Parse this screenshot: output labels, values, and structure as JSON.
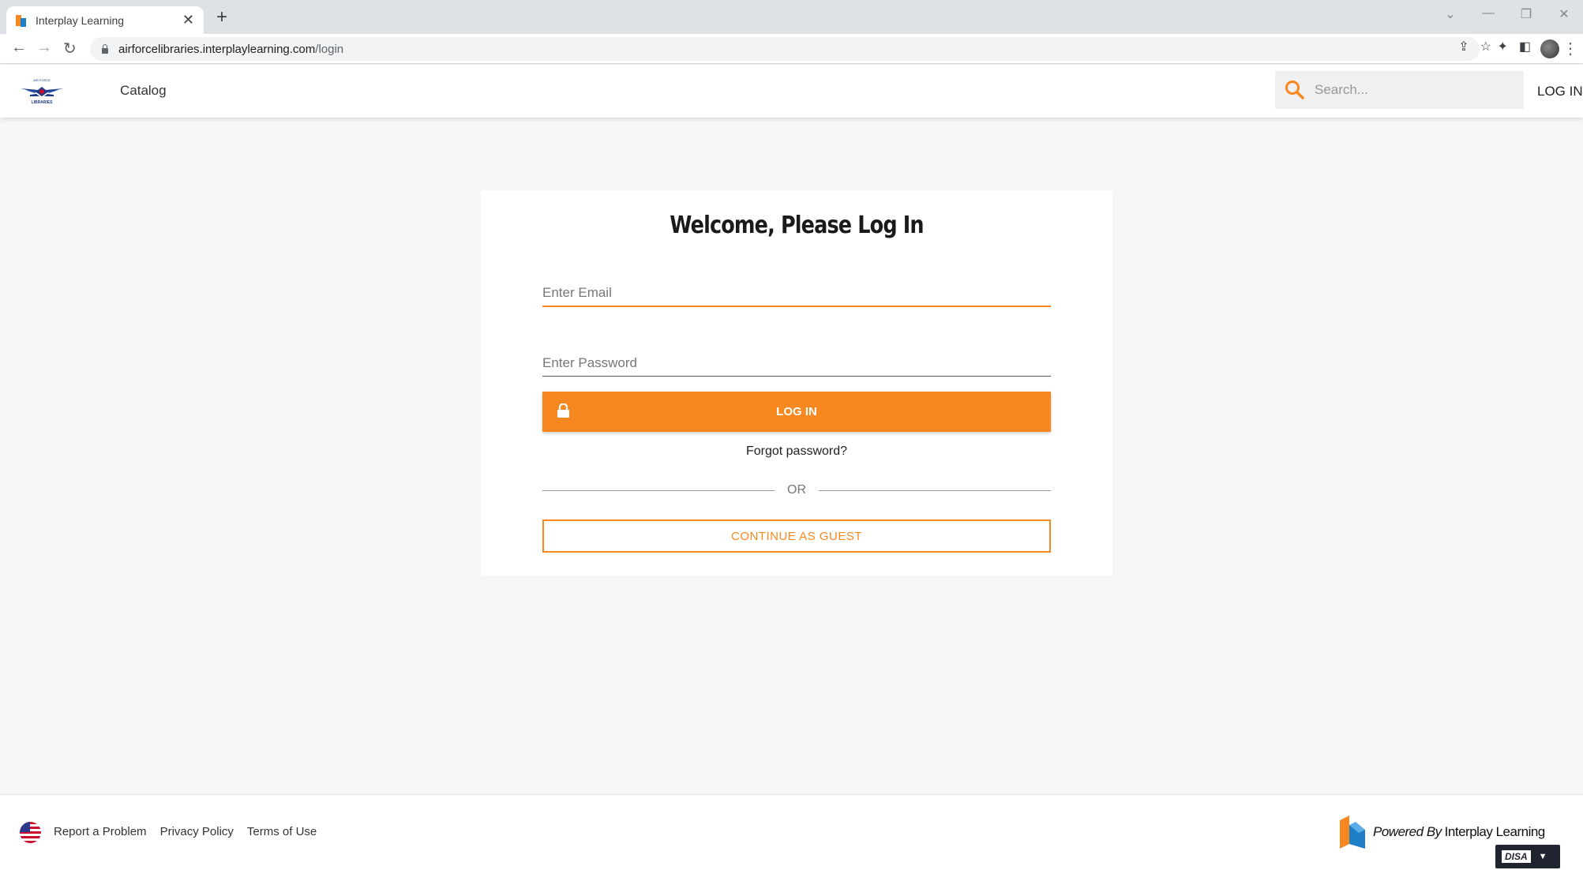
{
  "browser": {
    "tab_title": "Interplay Learning",
    "tab_close": "✕",
    "new_tab": "+",
    "url_host": "airforcelibraries.interplaylearning.com",
    "url_path": "/login"
  },
  "header": {
    "logo_text": "LIBRARIES",
    "nav_catalog": "Catalog",
    "search_placeholder": "Search...",
    "login_label": "LOG IN"
  },
  "login": {
    "title": "Welcome, Please Log In",
    "email_placeholder": "Enter Email",
    "password_placeholder": "Enter Password",
    "login_button": "LOG IN",
    "forgot_password": "Forgot password?",
    "or_text": "OR",
    "guest_button": "CONTINUE AS GUEST"
  },
  "footer": {
    "links": [
      "Report a Problem",
      "Privacy Policy",
      "Terms of Use"
    ],
    "powered_by": "Powered By",
    "brand": "Interplay Learning",
    "badge": "DISA"
  },
  "colors": {
    "accent": "#f7881f",
    "page_bg": "#f6f7f7"
  }
}
